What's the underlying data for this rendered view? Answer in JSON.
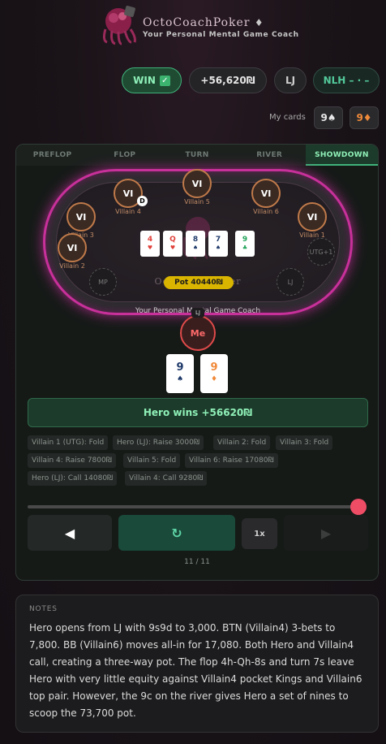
{
  "header": {
    "brand_name": "OctoCoachPoker",
    "brand_suffix": "♦",
    "tagline": "Your Personal Mental Game Coach"
  },
  "summary": {
    "result": "WIN",
    "amount": "+56,620₪",
    "position": "LJ",
    "game": "NLH – · –"
  },
  "my_cards": {
    "label": "My cards",
    "cards": [
      {
        "rank": "9",
        "suit": "♠"
      },
      {
        "rank": "9",
        "suit": "♦"
      }
    ]
  },
  "tabs": [
    {
      "label": "PREFLOP",
      "active": false
    },
    {
      "label": "FLOP",
      "active": false
    },
    {
      "label": "TURN",
      "active": false
    },
    {
      "label": "RIVER",
      "active": false
    },
    {
      "label": "SHOWDOWN",
      "active": true
    }
  ],
  "table": {
    "brand": "OctoCoachPoker",
    "tagline": "Your Personal Mental Game Coach",
    "seats": [
      {
        "tag": "VI",
        "name": "Villain 5"
      },
      {
        "tag": "VI",
        "name": "Villain 4"
      },
      {
        "tag": "VI",
        "name": "Villain 6"
      },
      {
        "tag": "VI",
        "name": "Villain 3"
      },
      {
        "tag": "VI",
        "name": "Villain 1"
      },
      {
        "tag": "VI",
        "name": "Villain 2"
      }
    ],
    "empty_seats": [
      "MP",
      "UTG+1",
      "LJ"
    ],
    "dealer": "D",
    "board": [
      {
        "rank": "4",
        "suit": "♥",
        "color": "#e0403a"
      },
      {
        "rank": "Q",
        "suit": "♥",
        "color": "#e0403a"
      },
      {
        "rank": "8",
        "suit": "♠",
        "color": "#1f3a6a"
      },
      {
        "rank": "7",
        "suit": "♠",
        "color": "#1f3a6a"
      },
      {
        "rank": "9",
        "suit": "♣",
        "color": "#22a35a"
      }
    ],
    "pot": "Pot 40440₪",
    "hero": {
      "label": "Me",
      "position": "LJ"
    },
    "hero_cards": [
      {
        "rank": "9",
        "suit": "♠",
        "color": "#1f3a6a"
      },
      {
        "rank": "9",
        "suit": "♦",
        "color": "#f08a3a"
      }
    ]
  },
  "result_banner": "Hero wins +56620₪",
  "actions": [
    "Villain 1 (UTG): Fold",
    "Hero (LJ): Raise 3000₪",
    "Villain 2: Fold",
    "Villain 3: Fold",
    "Villain 4: Raise 7800₪",
    "Villain 5: Fold",
    "Villain 6: Raise 17080₪",
    "Hero (LJ): Call 14080₪",
    "Villain 4: Call 9280₪"
  ],
  "controls": {
    "prev": "◀",
    "replay": "↻",
    "speed": "1x",
    "next": "▶",
    "progress": "11 / 11"
  },
  "notes": {
    "title": "NOTES",
    "body": "Hero opens from LJ with 9s9d to 3,000. BTN (Villain4) 3-bets to 7,800. BB (Villain6) moves all-in for 17,080. Both Hero and Villain4 call, creating a three-way pot. The flop 4h-Qh-8s and turn 7s leave Hero with very little equity against Villain4 pocket Kings and Villain6 top pair. However, the 9c on the river gives Hero a set of nines to scoop the 73,700 pot."
  },
  "colors": {
    "accent_green": "#3fb27a",
    "table_neon": "#c8309a",
    "pot_yellow": "#d9b500",
    "hero_red": "#e04a4a"
  }
}
